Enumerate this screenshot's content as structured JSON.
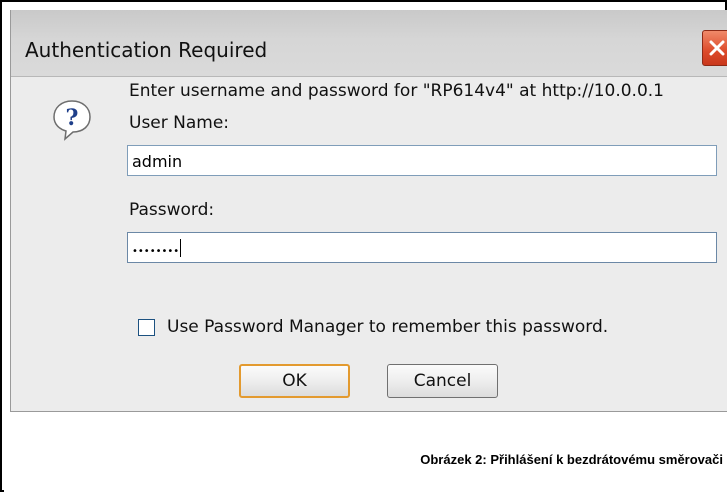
{
  "dialog": {
    "title": "Authentication Required",
    "close_icon": "close-icon",
    "help_icon": "question-bubble-icon",
    "message": "Enter username and password for \"RP614v4\" at http://10.0.0.1",
    "username_label": "User Name:",
    "username_value": "admin",
    "password_label": "Password:",
    "password_mask": "••••••••",
    "remember_label": "Use Password Manager to remember this password.",
    "remember_checked": false,
    "ok_label": "OK",
    "cancel_label": "Cancel"
  },
  "caption": {
    "text": "Obrázek 2: Přihlášení k bezdrátovému směrovači"
  },
  "colors": {
    "close_button": "#dc4a2a",
    "default_button_border": "#e39a2f",
    "dialog_background": "#ececec"
  }
}
